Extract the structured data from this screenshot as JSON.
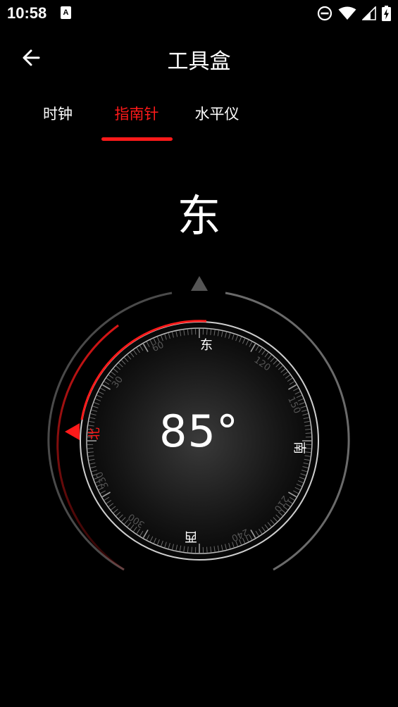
{
  "status_bar": {
    "time": "10:58",
    "notification_badge": "A",
    "icons": [
      "do-not-disturb-icon",
      "wifi-icon",
      "signal-icon",
      "battery-charging-icon"
    ]
  },
  "app_bar": {
    "back_icon": "arrow-left-icon",
    "title": "工具盒"
  },
  "tabs": [
    {
      "label": "时钟",
      "active": false
    },
    {
      "label": "指南针",
      "active": true
    },
    {
      "label": "水平仪",
      "active": false
    }
  ],
  "compass": {
    "direction": "东",
    "heading": "85°",
    "heading_degrees": 85,
    "cardinals": {
      "north": "北",
      "east": "东",
      "south": "南",
      "west": "西"
    },
    "degree_labels": [
      "30",
      "60",
      "120",
      "150",
      "210",
      "240",
      "300",
      "330"
    ],
    "accent_color": "#ff1a1a"
  }
}
